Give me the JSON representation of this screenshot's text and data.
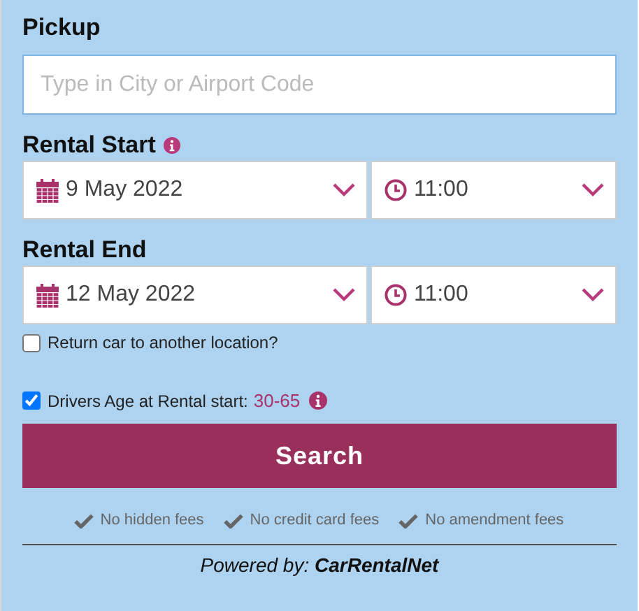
{
  "pickup": {
    "label": "Pickup",
    "placeholder": "Type in City or Airport Code"
  },
  "rental_start": {
    "label": "Rental Start",
    "date": "9 May 2022",
    "time": "11:00"
  },
  "rental_end": {
    "label": "Rental End",
    "date": "12 May 2022",
    "time": "11:00"
  },
  "return_other": {
    "label": "Return car to another location?",
    "checked": false
  },
  "drivers_age": {
    "label": "Drivers Age at Rental start:",
    "value": "30-65",
    "checked": true
  },
  "search_button": "Search",
  "features": [
    "No hidden fees",
    "No credit card fees",
    "No amendment fees"
  ],
  "powered_by": "Powered by: **CarRentalNet**"
}
